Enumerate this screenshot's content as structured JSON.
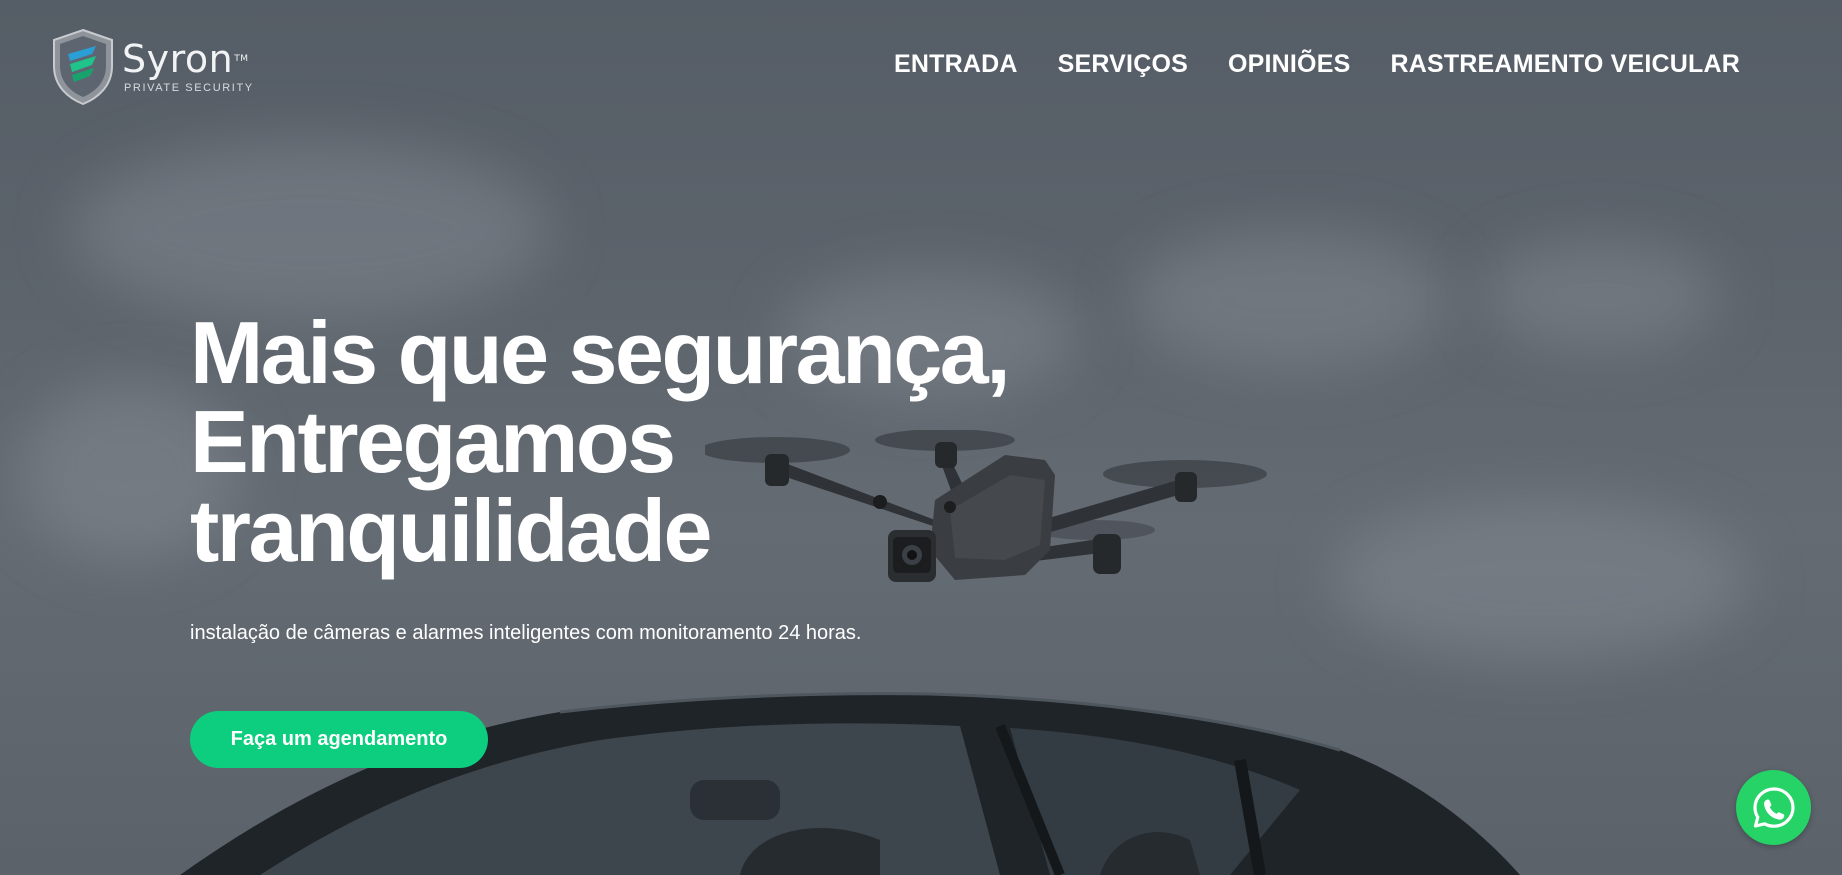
{
  "brand": {
    "name": "Syron",
    "trademark": "TM",
    "tagline": "PRIVATE SECURITY"
  },
  "nav": {
    "items": [
      {
        "label": "ENTRADA"
      },
      {
        "label": "SERVIÇOS"
      },
      {
        "label": "OPINIÕES"
      },
      {
        "label": "RASTREAMENTO VEICULAR"
      }
    ]
  },
  "hero": {
    "headline_lines": [
      "Mais que segurança,",
      "Entregamos",
      "tranquilidade"
    ],
    "subtitle": "instalação de câmeras e alarmes inteligentes com monitoramento 24 horas.",
    "cta_label": "Faça um agendamento"
  },
  "icons": {
    "logo": "shield-logo-icon",
    "whatsapp": "whatsapp-icon",
    "drone": "drone-image",
    "car": "car-image"
  },
  "colors": {
    "accent": "#0cce7e",
    "whatsapp": "#25d366",
    "text": "#ffffff"
  }
}
